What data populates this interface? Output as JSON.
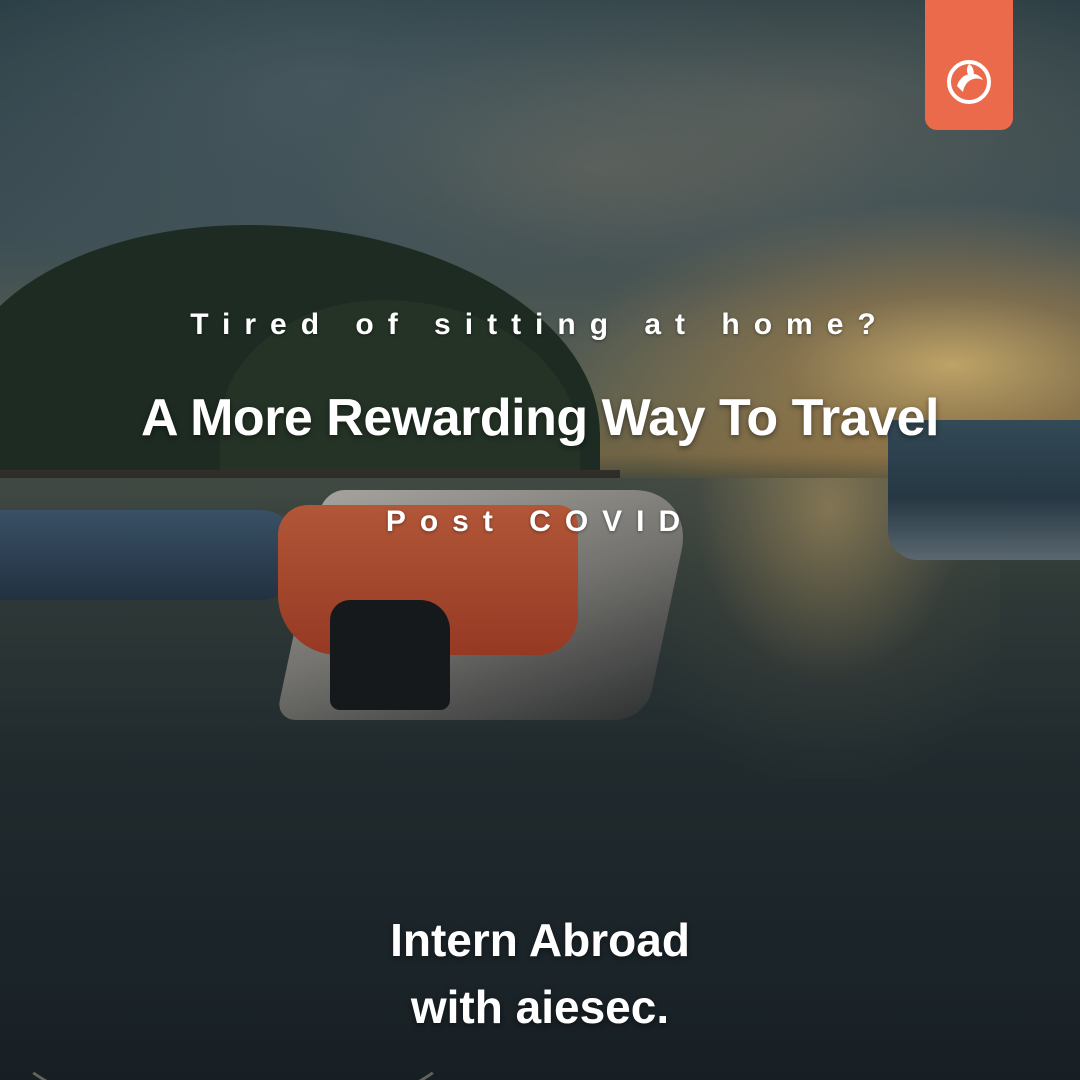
{
  "poster": {
    "tagline": "Tired of sitting at home?",
    "headline": "A More Rewarding Way To Travel",
    "subline": "Post COVID",
    "cta_line1": "Intern Abroad",
    "cta_line2": "with aiesec."
  },
  "brand": {
    "logo_icon": "aiesec-logo-icon",
    "accent_color": "#ec6a4c"
  },
  "photo": {
    "scene": "harbor-boats-sunset"
  }
}
